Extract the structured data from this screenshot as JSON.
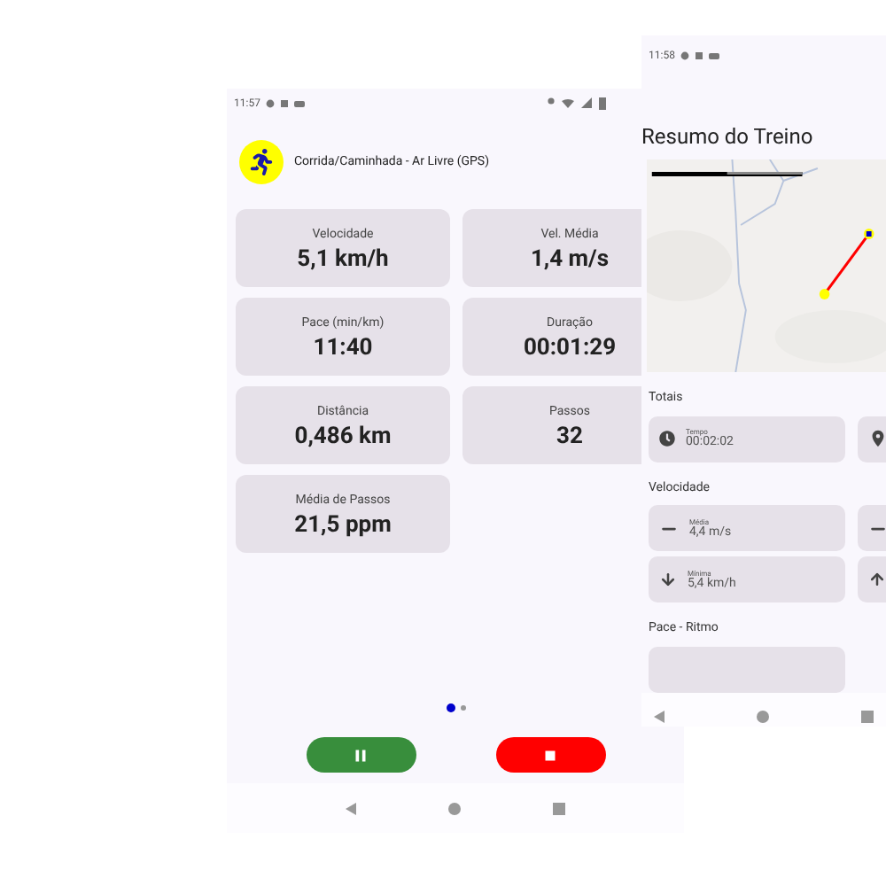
{
  "workout_screen": {
    "status_bar": {
      "time": "11:57"
    },
    "activity": {
      "title": "Corrida/Caminhada - Ar Livre (GPS)"
    },
    "metrics": [
      {
        "label": "Velocidade",
        "value": "5,1 km/h"
      },
      {
        "label": "Vel. Média",
        "value": "1,4 m/s"
      },
      {
        "label": "Pace (min/km)",
        "value": "11:40"
      },
      {
        "label": "Duração",
        "value": "00:01:29"
      },
      {
        "label": "Distância",
        "value": "0,486 km"
      },
      {
        "label": "Passos",
        "value": "32"
      },
      {
        "label": "Média de Passos",
        "value": "21,5 ppm"
      }
    ],
    "pager": [
      {
        "selected": true
      },
      {
        "selected": false
      }
    ],
    "buttons": [
      {
        "kind": "pause"
      },
      {
        "kind": "stop"
      }
    ]
  },
  "summary_screen": {
    "status_bar": {
      "time": "11:58"
    },
    "title": "Resumo do Treino",
    "sections": [
      {
        "title": "Totais",
        "cards": [
          {
            "kind": "clock",
            "label": "Tempo",
            "value": "00:02:02"
          },
          {
            "kind": "pin"
          }
        ]
      },
      {
        "title": "Velocidade",
        "cards": [
          {
            "kind": "dash",
            "label": "Média",
            "value": "4,4 m/s"
          },
          {
            "kind": "dash"
          },
          {
            "kind": "down",
            "label": "Mínima",
            "value": "5,4 km/h"
          },
          {
            "kind": "up"
          }
        ]
      },
      {
        "title": "Pace - Ritmo",
        "cards": [
          {
            "kind": "blank"
          }
        ]
      }
    ]
  }
}
